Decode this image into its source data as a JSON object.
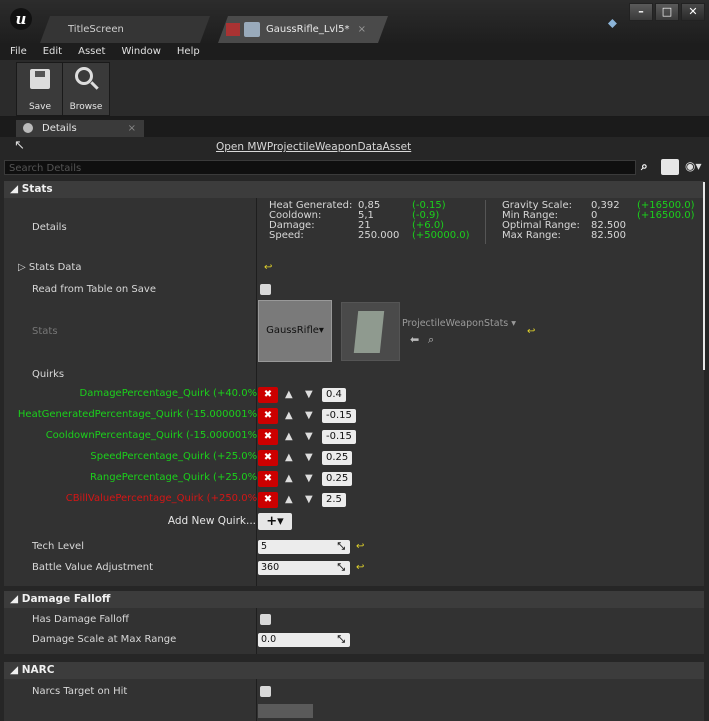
{
  "window": {
    "tabs": [
      {
        "label": "TitleScreen"
      },
      {
        "label": "GaussRifle_Lvl5*"
      }
    ],
    "tab_close": "×",
    "buttons": {
      "minimize": "–",
      "maximize": "□",
      "close": "✕"
    }
  },
  "menu": [
    "File",
    "Edit",
    "Asset",
    "Window",
    "Help"
  ],
  "toolbar": {
    "save_label": "Save",
    "browse_label": "Browse"
  },
  "details_tab": {
    "label": "Details",
    "close": "×"
  },
  "open_link": "Open MWProjectileWeaponDataAsset",
  "search": {
    "placeholder": "Search Details"
  },
  "stats": {
    "header": "Stats",
    "details_label": "Details",
    "left_stats": [
      {
        "name": "Heat Generated:",
        "value": "0,85",
        "delta": "(-0.15)"
      },
      {
        "name": "Cooldown:",
        "value": "5,1",
        "delta": "(-0.9)"
      },
      {
        "name": "Damage:",
        "value": "21",
        "delta": "(+6.0)"
      },
      {
        "name": "Speed:",
        "value": "250.000",
        "delta": "(+50000.0)"
      }
    ],
    "right_stats": [
      {
        "name": "Gravity Scale:",
        "value": "0,392",
        "delta": ""
      },
      {
        "name": "Min Range:",
        "value": "0",
        "delta": ""
      },
      {
        "name": "Optimal Range:",
        "value": "82.500",
        "delta": "(+16500.0)"
      },
      {
        "name": "Max Range:",
        "value": "82.500",
        "delta": "(+16500.0)"
      }
    ],
    "stats_data_label": "Stats Data",
    "read_from_table_label": "Read from Table on Save",
    "stats_label": "Stats",
    "stats_asset_name": "GaussRifle",
    "stats_asset_picker": "ProjectileWeaponStats",
    "quirks_label": "Quirks",
    "quirks": [
      {
        "name": "DamagePercentage_Quirk (+40.0%)",
        "value": "0.4",
        "color": "#1bd11b"
      },
      {
        "name": "HeatGeneratedPercentage_Quirk (-15.000001%)",
        "value": "-0.15",
        "color": "#1bd11b"
      },
      {
        "name": "CooldownPercentage_Quirk (-15.000001%)",
        "value": "-0.15",
        "color": "#1bd11b"
      },
      {
        "name": "SpeedPercentage_Quirk (+25.0%)",
        "value": "0.25",
        "color": "#1bd11b"
      },
      {
        "name": "RangePercentage_Quirk (+25.0%)",
        "value": "0.25",
        "color": "#1bd11b"
      },
      {
        "name": "CBillValuePercentage_Quirk (+250.0%)",
        "value": "2.5",
        "color": "#d41616"
      }
    ],
    "add_quirk_label": "Add New Quirk...",
    "tech_level_label": "Tech Level",
    "tech_level_value": "5",
    "battle_value_label": "Battle Value Adjustment",
    "battle_value_value": "360"
  },
  "damage_falloff": {
    "header": "Damage Falloff",
    "has_label": "Has Damage Falloff",
    "scale_label": "Damage Scale at Max Range",
    "scale_value": "0.0"
  },
  "narc": {
    "header": "NARC",
    "target_label": "Narcs Target on Hit"
  }
}
